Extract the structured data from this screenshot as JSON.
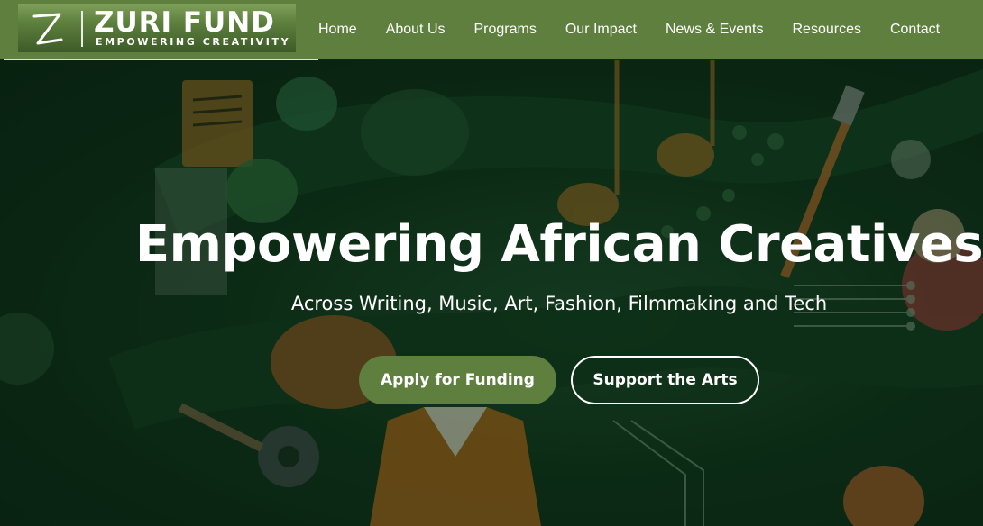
{
  "brand": {
    "name": "ZURI FUND",
    "tagline": "EMPOWERING CREATIVITY",
    "logo_icon": "z-brushstroke-icon"
  },
  "nav": {
    "items": [
      {
        "label": "Home"
      },
      {
        "label": "About Us"
      },
      {
        "label": "Programs"
      },
      {
        "label": "Our Impact"
      },
      {
        "label": "News & Events"
      },
      {
        "label": "Resources"
      },
      {
        "label": "Contact"
      }
    ]
  },
  "hero": {
    "headline": "Empowering African Creatives",
    "subheadline": "Across Writing, Music, Art, Fashion, Filmmaking and Tech",
    "primary_cta": "Apply for Funding",
    "secondary_cta": "Support the Arts",
    "background_motifs": [
      "book-icon",
      "music-note-icon",
      "paintbrush-icon",
      "film-reel-icon",
      "shirt-icon",
      "globe-icon",
      "circuit-icon"
    ]
  },
  "colors": {
    "accent": "#5f7f3f",
    "hero_background": "#0f3219",
    "text": "#ffffff"
  }
}
